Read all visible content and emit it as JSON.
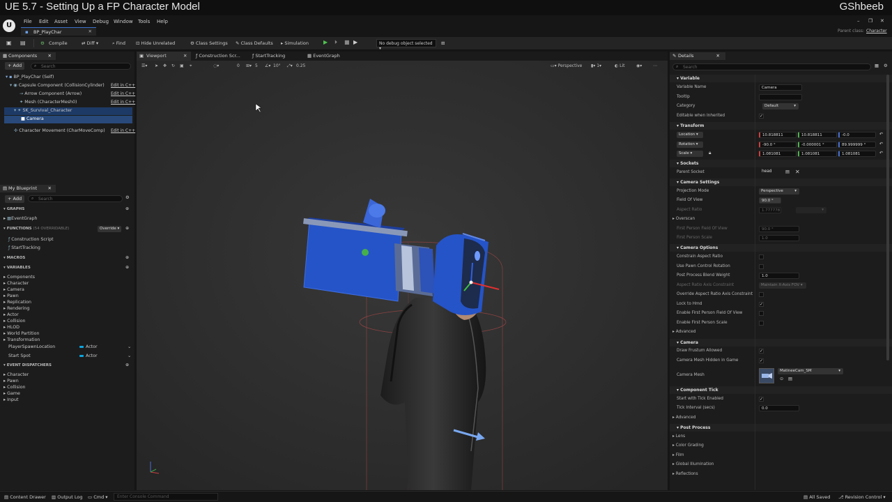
{
  "video": {
    "title": "UE 5.7 - Setting Up a FP Character Model",
    "channel": "GShbeeb"
  },
  "menu": [
    "File",
    "Edit",
    "Asset",
    "View",
    "Debug",
    "Window",
    "Tools",
    "Help"
  ],
  "document_tab": "BP_PlayChar",
  "parent_class": {
    "label": "Parent class:",
    "value": "Character"
  },
  "toolbar": {
    "compile": "Compile",
    "diff": "Diff",
    "find": "Find",
    "hide_unrelated": "Hide Unrelated",
    "class_settings": "Class Settings",
    "class_defaults": "Class Defaults",
    "simulation": "Simulation",
    "debug_select": "No debug object selected"
  },
  "components_panel": {
    "tab": "Components",
    "add": "Add",
    "search_placeholder": "Search",
    "root": "BP_PlayChar (Self)",
    "items": [
      {
        "label": "Capsule Component (CollisionCylinder)",
        "edit": "Edit in C++"
      },
      {
        "label": "Arrow Component (Arrow)",
        "edit": "Edit in C++"
      },
      {
        "label": "Mesh (CharacterMesh0)",
        "edit": "Edit in C++"
      },
      {
        "label": "SK_Survival_Character",
        "edit": ""
      },
      {
        "label": "Camera",
        "edit": ""
      },
      {
        "label": "Character Movement (CharMoveComp)",
        "edit": "Edit in C++"
      }
    ]
  },
  "blueprint_panel": {
    "tab": "My Blueprint",
    "add": "Add",
    "search_placeholder": "Search",
    "graphs_hdr": "GRAPHS",
    "event_graph": "EventGraph",
    "functions_hdr": "FUNCTIONS",
    "functions_count": "(54 OVERRIDABLE)",
    "override": "Override",
    "functions": [
      "Construction Script",
      "StartTracking"
    ],
    "macros_hdr": "MACROS",
    "variables_hdr": "VARIABLES",
    "variable_groups": [
      "Components",
      "Character",
      "Camera",
      "Pawn",
      "Replication",
      "Rendering",
      "Actor",
      "Collision",
      "HLOD",
      "World Partition",
      "Transformation"
    ],
    "variables": [
      {
        "name": "PlayerSpawnLocation",
        "type": "Actor"
      },
      {
        "name": "Start Spot",
        "type": "Actor"
      }
    ],
    "dispatchers_hdr": "EVENT DISPATCHERS",
    "dispatchers": [
      "Character",
      "Pawn",
      "Collision",
      "Game",
      "Input"
    ]
  },
  "editor_tabs": [
    "Viewport",
    "Construction Scr...",
    "StartTracking",
    "EventGraph"
  ],
  "viewport": {
    "perspective": "Perspective",
    "lit": "Lit",
    "snap_translate": "0",
    "snap_rotate": "10°",
    "snap_scale": "0.25"
  },
  "details": {
    "tab": "Details",
    "search_placeholder": "Search",
    "variable": {
      "hdr": "Variable",
      "variable_name": {
        "label": "Variable Name",
        "value": "Camera"
      },
      "tooltip": {
        "label": "Tooltip",
        "value": ""
      },
      "category": {
        "label": "Category",
        "value": "Default"
      },
      "editable": {
        "label": "Editable when Inherited"
      }
    },
    "transform": {
      "hdr": "Transform",
      "location": {
        "label": "Location",
        "x": "10.818811",
        "y": "10.818811",
        "z": "-0.0"
      },
      "rotation": {
        "label": "Rotation",
        "x": "-90.0 °",
        "y": "-0.000001 °",
        "z": "89.999999 °"
      },
      "scale": {
        "label": "Scale",
        "x": "1.081081",
        "y": "1.081081",
        "z": "1.081081"
      }
    },
    "sockets": {
      "hdr": "Sockets",
      "parent_socket": {
        "label": "Parent Socket",
        "value": "head"
      }
    },
    "camera_settings": {
      "hdr": "Camera Settings",
      "projection_mode": {
        "label": "Projection Mode",
        "value": "Perspective"
      },
      "fov": {
        "label": "Field Of View",
        "value": "90.0 °"
      },
      "aspect_ratio": {
        "label": "Aspect Ratio",
        "value": "1.777778"
      },
      "overscan": "Overscan",
      "fp_fov": {
        "label": "First Person Field Of View",
        "value": "90.0 °"
      },
      "fp_scale": {
        "label": "First Person Scale",
        "value": "1.0"
      }
    },
    "camera_options": {
      "hdr": "Camera Options",
      "constrain": "Constrain Aspect Ratio",
      "use_pawn": "Use Pawn Control Rotation",
      "pp_blend": {
        "label": "Post Process Blend Weight",
        "value": "1.0"
      },
      "axis_constraint": {
        "label": "Aspect Ratio Axis Constraint",
        "value": "Maintain X-Axis FOV"
      },
      "override_axis": "Override Aspect Ratio Axis Constraint",
      "lock_hmd": "Lock to Hmd",
      "enable_fp_fov": "Enable First Person Field Of View",
      "enable_fp_scale": "Enable First Person Scale",
      "advanced": "Advanced"
    },
    "camera": {
      "hdr": "Camera",
      "draw_frustum": "Draw Frustum Allowed",
      "mesh_hidden": "Camera Mesh Hidden in Game",
      "camera_mesh": {
        "label": "Camera Mesh",
        "value": "MatineeCam_SM"
      }
    },
    "component_tick": {
      "hdr": "Component Tick",
      "start_tick": "Start with Tick Enabled",
      "tick_interval": {
        "label": "Tick Interval (secs)",
        "value": "0.0"
      },
      "advanced": "Advanced"
    },
    "post_process": {
      "hdr": "Post Process",
      "items": [
        "Lens",
        "Color Grading",
        "Film",
        "Global Illumination",
        "Reflections"
      ]
    }
  },
  "statusbar": {
    "content_drawer": "Content Drawer",
    "output_log": "Output Log",
    "cmd": "Cmd",
    "console_placeholder": "Enter Console Command",
    "saved": "All Saved",
    "revision": "Revision Control"
  }
}
